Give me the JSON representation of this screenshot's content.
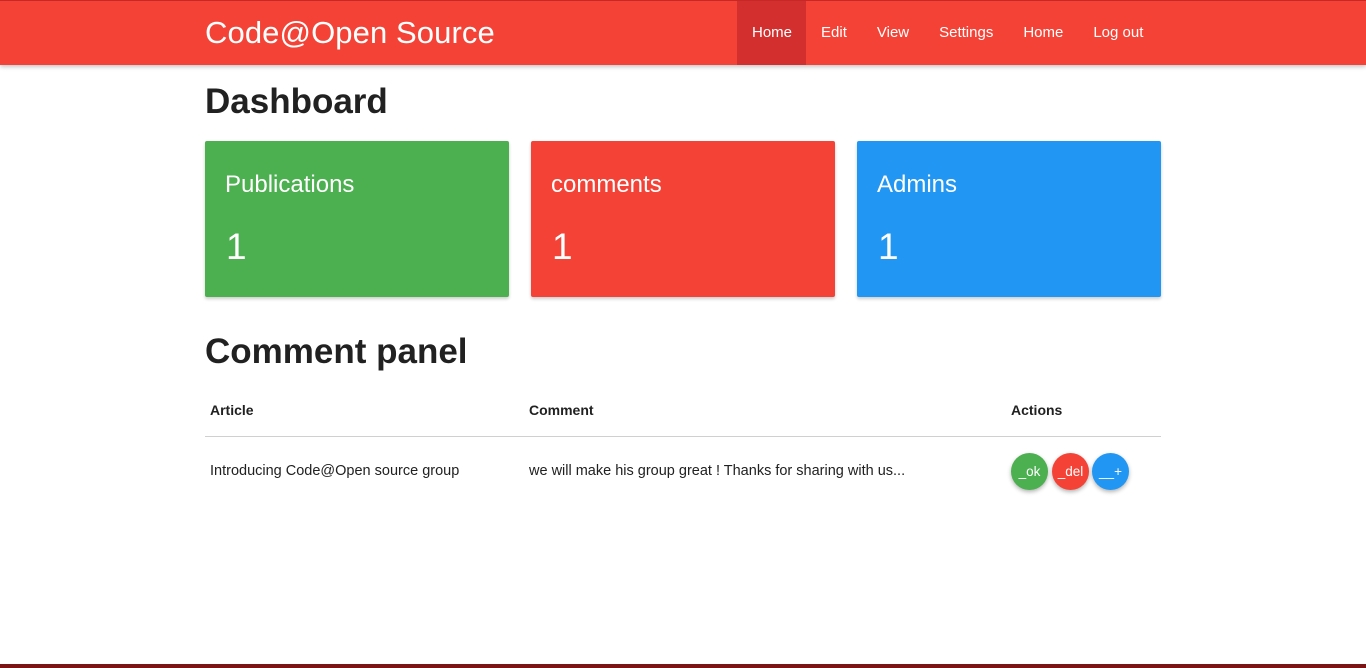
{
  "nav": {
    "brand": "Code@Open Source",
    "links": [
      {
        "label": "Home",
        "active": true
      },
      {
        "label": "Edit",
        "active": false
      },
      {
        "label": "View",
        "active": false
      },
      {
        "label": "Settings",
        "active": false
      },
      {
        "label": "Home",
        "active": false
      },
      {
        "label": "Log out",
        "active": false
      }
    ]
  },
  "dashboard": {
    "title": "Dashboard",
    "cards": [
      {
        "title": "Publications",
        "count": "1",
        "color": "#4caf50"
      },
      {
        "title": "comments",
        "count": "1",
        "color": "#f44336"
      },
      {
        "title": "Admins",
        "count": "1",
        "color": "#2196f3"
      }
    ]
  },
  "comments": {
    "title": "Comment panel",
    "headers": {
      "article": "Article",
      "comment": "Comment",
      "actions": "Actions"
    },
    "rows": [
      {
        "article": "Introducing Code@Open source group",
        "comment": "we will make his group great ! Thanks for sharing with us...",
        "actions": {
          "ok": "_ok",
          "del": "_del",
          "add": "__+"
        }
      }
    ]
  },
  "colors": {
    "primary": "#f44336",
    "primary_dark": "#d32f2f",
    "success": "#4caf50",
    "danger": "#f44336",
    "info": "#2196f3"
  }
}
